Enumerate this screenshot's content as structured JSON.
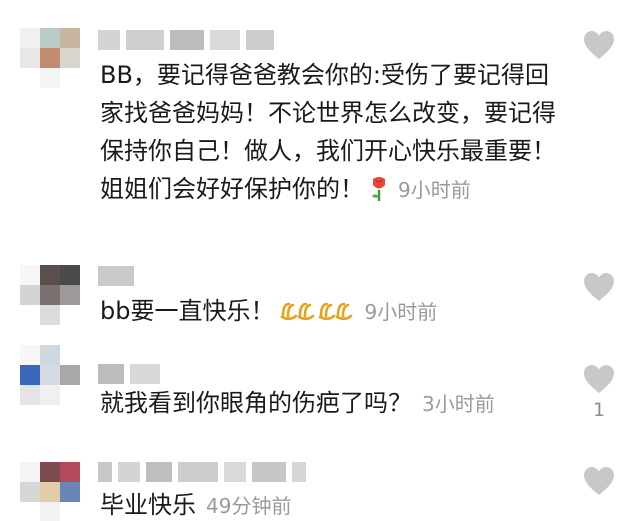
{
  "comments": [
    {
      "text": "BB，要记得爸爸教会你的:受伤了要记得回家找爸爸妈妈！不论世界怎么改变，要记得保持你自己！做人，我们开心快乐最重要！姐姐们会好好保护你的！",
      "emoji": "rose-icon",
      "time": "9小时前",
      "likes": ""
    },
    {
      "text": "bb要一直快乐！",
      "emoji": "clapping-hands-icon",
      "time": "9小时前",
      "likes": ""
    },
    {
      "text": "就我看到你眼角的伤疤了吗？",
      "time": "3小时前",
      "likes": "1"
    },
    {
      "text": "毕业快乐",
      "time": "49分钟前",
      "likes": ""
    }
  ],
  "colors": {
    "text": "#1a1a1a",
    "time": "#9a9a9a",
    "like_icon": "#c8c8c8",
    "rose": "#e8463a"
  }
}
